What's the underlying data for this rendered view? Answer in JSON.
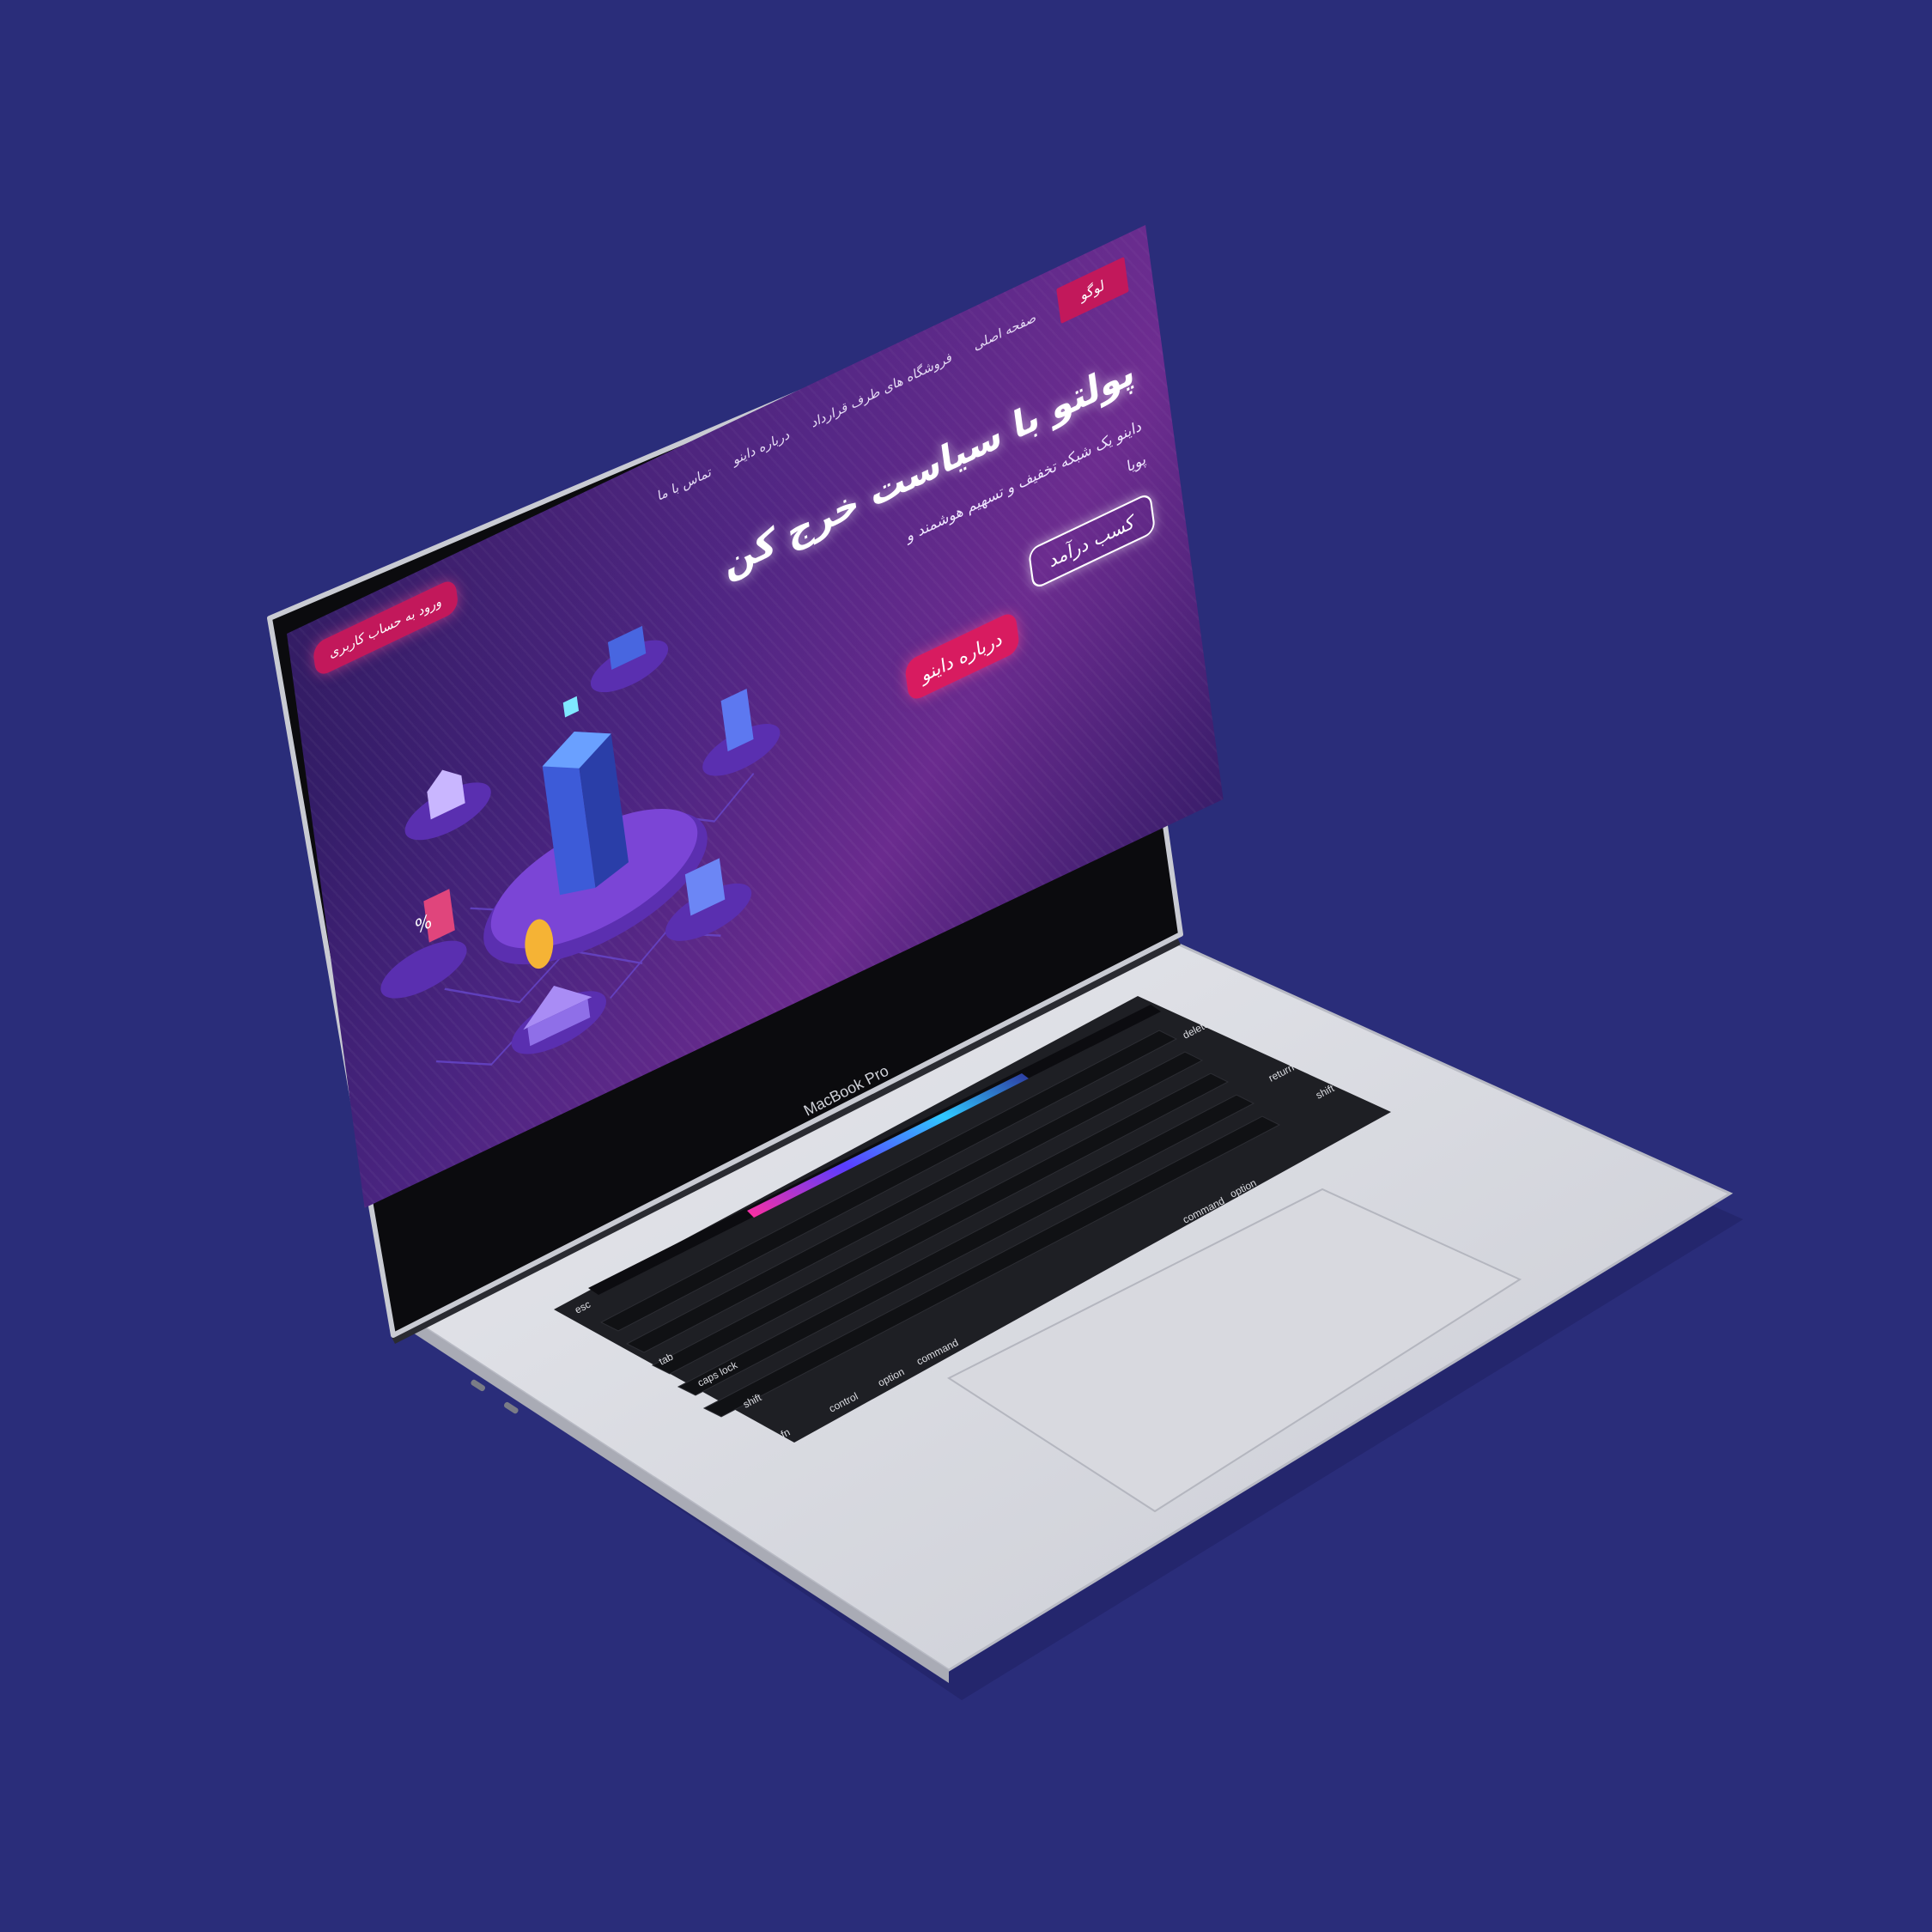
{
  "nav": {
    "logo": "لوگو",
    "links": [
      "صفحه اصلی",
      "فروشگاه های طرف قرارداد",
      "درباره داینو",
      "تماس با ما"
    ]
  },
  "login": "ورود به حساب کاربری",
  "hero": {
    "title": "پولتو با سیاست خرج کن",
    "subtitle": "داینو یک شبکه تخفیف و تسهیم هوشمند و پویا",
    "btn_income": "کسب درآمد",
    "btn_about": "درباره داینو"
  },
  "device": {
    "brand": "MacBook Pro",
    "keys": {
      "esc": "esc",
      "delete": "delete",
      "return": "return",
      "shift": "shift",
      "tab": "tab",
      "caps": "caps lock",
      "lshift": "shift",
      "fn": "fn",
      "control": "control",
      "option": "option",
      "command": "command",
      "rcommand": "command",
      "roption": "option"
    }
  },
  "colors": {
    "background": "#2a2d7a",
    "accent": "#c2185b",
    "site_purple": "#4a2480"
  }
}
